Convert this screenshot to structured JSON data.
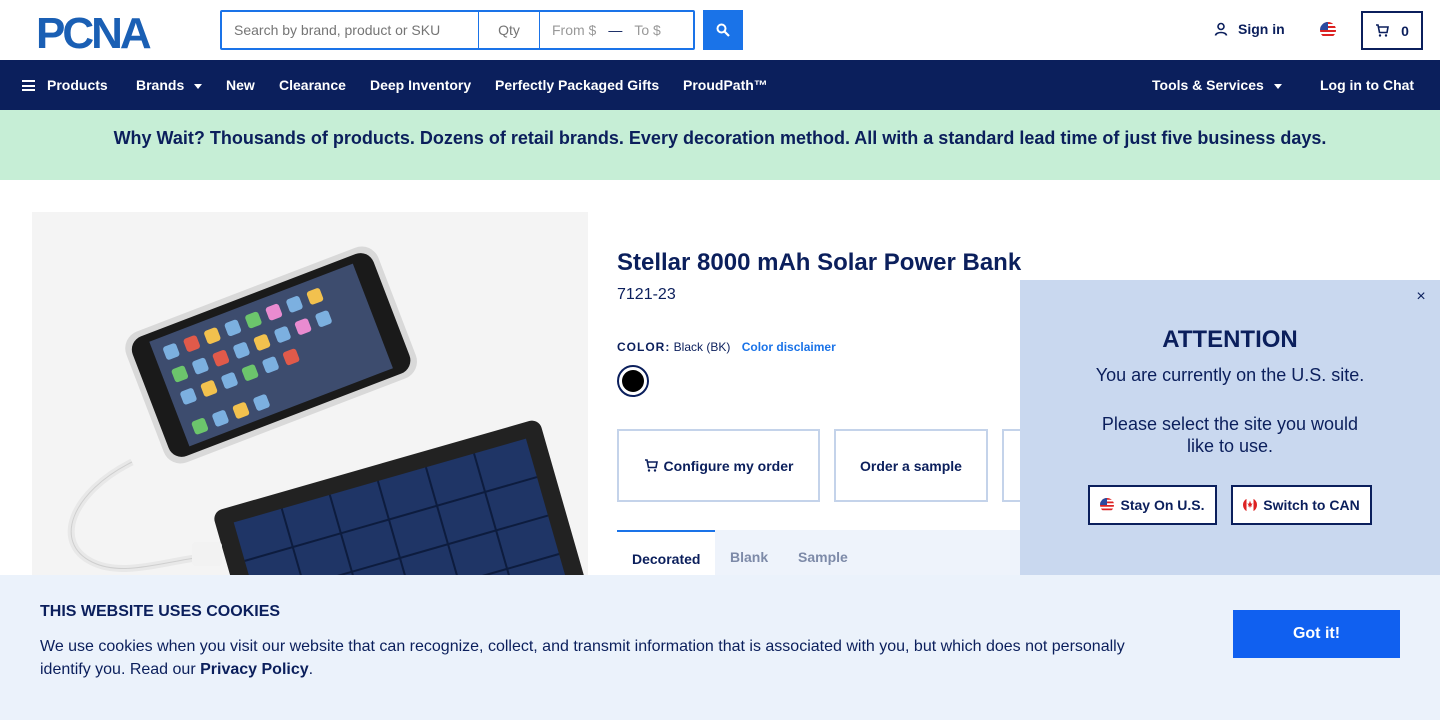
{
  "header": {
    "logo_text": "PCNA",
    "search_placeholder": "Search by brand, product or SKU",
    "qty_placeholder": "Qty",
    "price_from_placeholder": "From $",
    "price_to_placeholder": "To $",
    "price_separator": "—",
    "sign_in_label": "Sign in",
    "cart_count": "0"
  },
  "nav": {
    "products": "Products",
    "brands": "Brands",
    "new": "New",
    "clearance": "Clearance",
    "deep_inventory": "Deep Inventory",
    "packaged_gifts": "Perfectly Packaged Gifts",
    "proudpath": "ProudPath™",
    "tools_services": "Tools & Services",
    "chat": "Log in to Chat"
  },
  "promo": {
    "text": "Why Wait? Thousands of products. Dozens of retail brands. Every decoration method. All with a standard lead time of just five business days."
  },
  "product": {
    "title": "Stellar 8000 mAh Solar Power Bank",
    "sku": "7121-23",
    "color_label": "COLOR:",
    "color_value": "Black (BK)",
    "color_disclaimer": "Color disclaimer",
    "swatch_color": "#000000",
    "configure_label": "Configure my order",
    "sample_label": "Order a sample",
    "tabs": [
      "Decorated",
      "Blank",
      "Sample"
    ]
  },
  "popup": {
    "close": "×",
    "title": "ATTENTION",
    "message": "You are currently on the U.S. site.",
    "message2": "Please select the site you would like to use.",
    "stay_label": "Stay On U.S.",
    "switch_label": "Switch to CAN"
  },
  "cookie": {
    "title": "THIS WEBSITE USES COOKIES",
    "text": "We use cookies when you visit our website that can recognize, collect, and transmit information that is associated with you, but which does not personally identify you. Read our",
    "link": "Privacy Policy",
    "period": ".",
    "button": "Got it!"
  },
  "colors": {
    "navy": "#0b1f5c",
    "accent_blue": "#1a73e8",
    "promo_bg": "#c6eed6",
    "cookie_bg": "#ebf2fb"
  }
}
